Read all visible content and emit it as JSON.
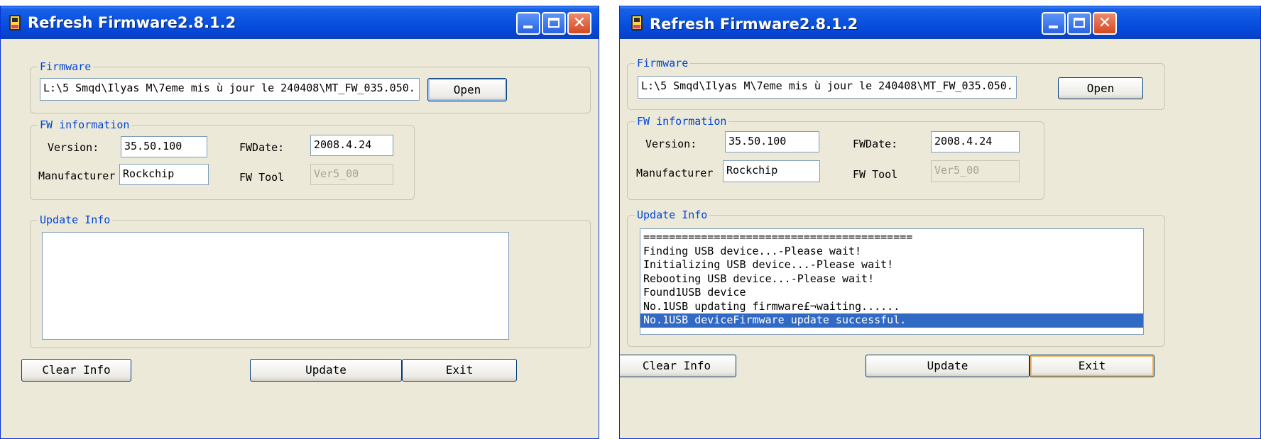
{
  "left_window": {
    "title": "Refresh Firmware2.8.1.2",
    "firmware": {
      "legend": "Firmware",
      "path": "L:\\5 Smqd\\Ilyas M\\7eme mis ù jour le 240408\\MT_FW_035.050.",
      "open_label": "Open"
    },
    "fw_info": {
      "legend": "FW information",
      "version_label": "Version:",
      "version_value": "35.50.100",
      "fwdate_label": "FWDate:",
      "fwdate_value": "2008.4.24",
      "manufacturer_label": "Manufacturer",
      "manufacturer_value": "Rockchip",
      "fwtool_label": "FW Tool",
      "fwtool_value": "Ver5_00"
    },
    "update_info": {
      "legend": "Update Info",
      "lines": []
    },
    "buttons": {
      "clear": "Clear Info",
      "update": "Update",
      "exit": "Exit"
    }
  },
  "right_window": {
    "title": "Refresh Firmware2.8.1.2",
    "firmware": {
      "legend": "Firmware",
      "path": "L:\\5 Smqd\\Ilyas M\\7eme mis ù jour le 240408\\MT_FW_035.050.",
      "open_label": "Open"
    },
    "fw_info": {
      "legend": "FW information",
      "version_label": "Version:",
      "version_value": "35.50.100",
      "fwdate_label": "FWDate:",
      "fwdate_value": "2008.4.24",
      "manufacturer_label": "Manufacturer",
      "manufacturer_value": "Rockchip",
      "fwtool_label": "FW Tool",
      "fwtool_value": "Ver5_00"
    },
    "update_info": {
      "legend": "Update Info",
      "lines": [
        "==========================================",
        "Finding USB device...-Please wait!",
        "Initializing USB device...-Please wait!",
        "Rebooting USB device...-Please wait!",
        "Found1USB device",
        "No.1USB updating firmware£¬waiting......",
        "No.1USB deviceFirmware update successful."
      ],
      "selected_line": 6
    },
    "buttons": {
      "clear": "Clear Info",
      "update": "Update",
      "exit": "Exit"
    }
  },
  "icons": {
    "app": "firmware-app-icon",
    "minimize": "minimize-icon",
    "maximize": "maximize-icon",
    "close": "close-icon"
  },
  "colors": {
    "titlebar": "#0a53e0",
    "group_legend": "#0046d5",
    "selection": "#316ac5",
    "window_bg": "#ece9d8"
  }
}
